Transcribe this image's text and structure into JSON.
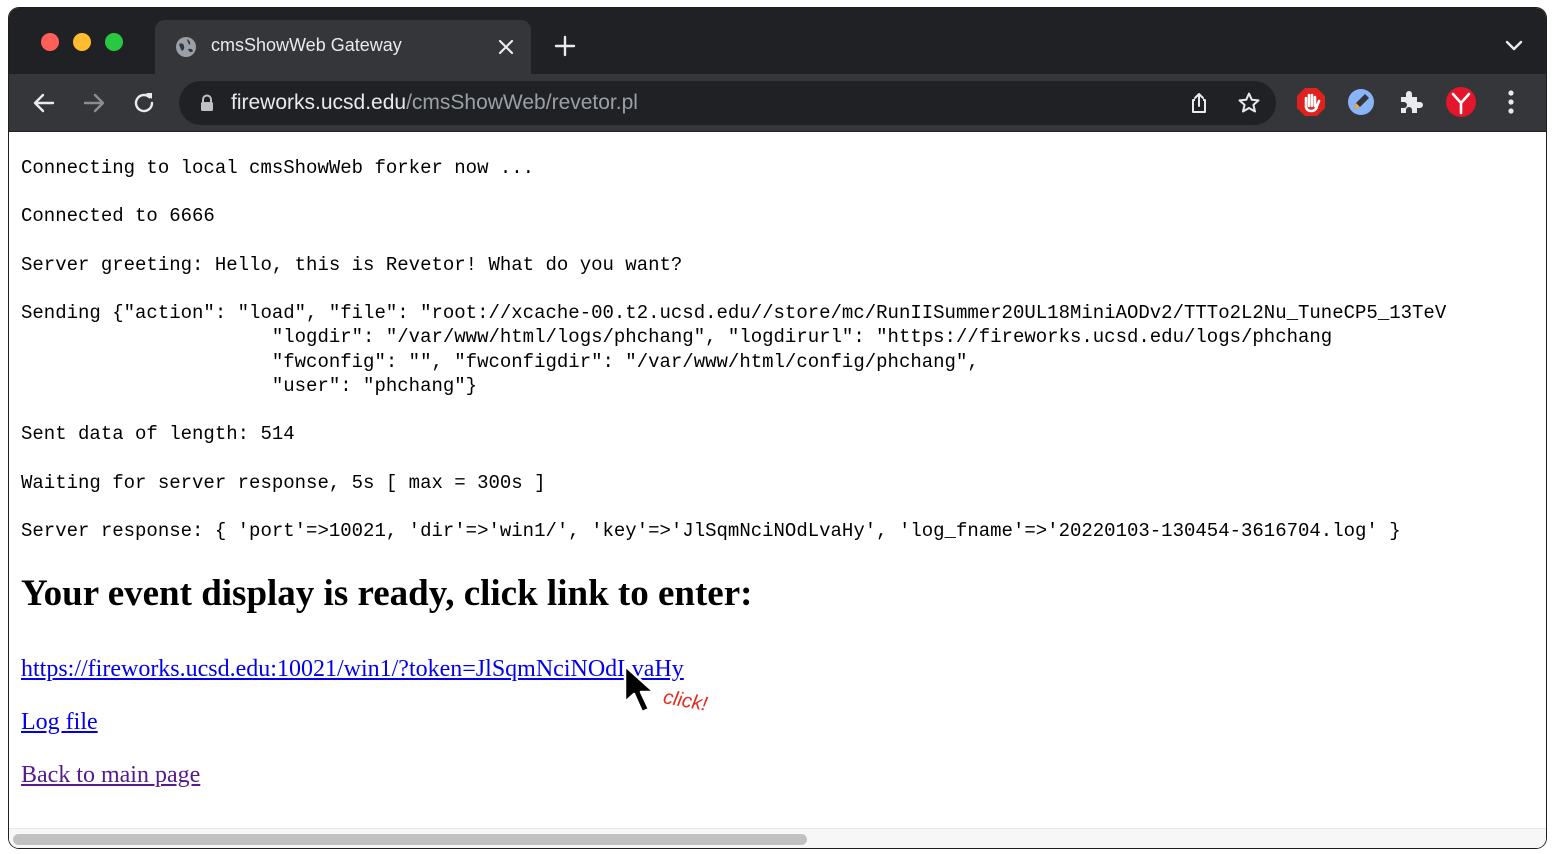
{
  "browser": {
    "tab": {
      "title": "cmsShowWeb Gateway"
    },
    "address_bar": {
      "host": "fireworks.ucsd.edu",
      "path": "/cmsShowWeb/revetor.pl"
    },
    "icons": {
      "tab_favicon": "globe-icon",
      "close": "close-icon",
      "new_tab": "plus-icon",
      "tab_list": "chevron-down-icon",
      "back": "arrow-left-icon",
      "forward": "arrow-right-icon",
      "reload": "reload-icon",
      "lock": "lock-icon",
      "share": "share-icon",
      "bookmark": "star-icon",
      "extensions": [
        "stop-hand-extension-icon",
        "pen-extension-icon",
        "puzzle-icon",
        "y-extension-icon"
      ],
      "menu": "kebab-menu-icon"
    },
    "colors": {
      "titlebar": "#202124",
      "toolbar": "#35363a",
      "link": "#0000ee",
      "visited_link": "#551a8b",
      "annotation": "#e52b1e"
    }
  },
  "page": {
    "log_text": "Connecting to local cmsShowWeb forker now ...\n\nConnected to 6666\n\nServer greeting: Hello, this is Revetor! What do you want?\n\nSending {\"action\": \"load\", \"file\": \"root://xcache-00.t2.ucsd.edu//store/mc/RunIISummer20UL18MiniAODv2/TTTo2L2Nu_TuneCP5_13TeV\n                      \"logdir\": \"/var/www/html/logs/phchang\", \"logdirurl\": \"https://fireworks.ucsd.edu/logs/phchang\n                      \"fwconfig\": \"\", \"fwconfigdir\": \"/var/www/html/config/phchang\",\n                      \"user\": \"phchang\"}\n\nSent data of length: 514\n\nWaiting for server response, 5s [ max = 300s ]\n\nServer response: { 'port'=>10021, 'dir'=>'win1/', 'key'=>'JlSqmNciNOdLvaHy', 'log_fname'=>'20220103-130454-3616704.log' }",
    "heading": "Your event display is ready, click link to enter:",
    "links": {
      "token": "https://fireworks.ucsd.edu:10021/win1/?token=JlSqmNciNOdLvaHy",
      "log": "Log file",
      "back": "Back to main page"
    },
    "annotation": "click!"
  }
}
